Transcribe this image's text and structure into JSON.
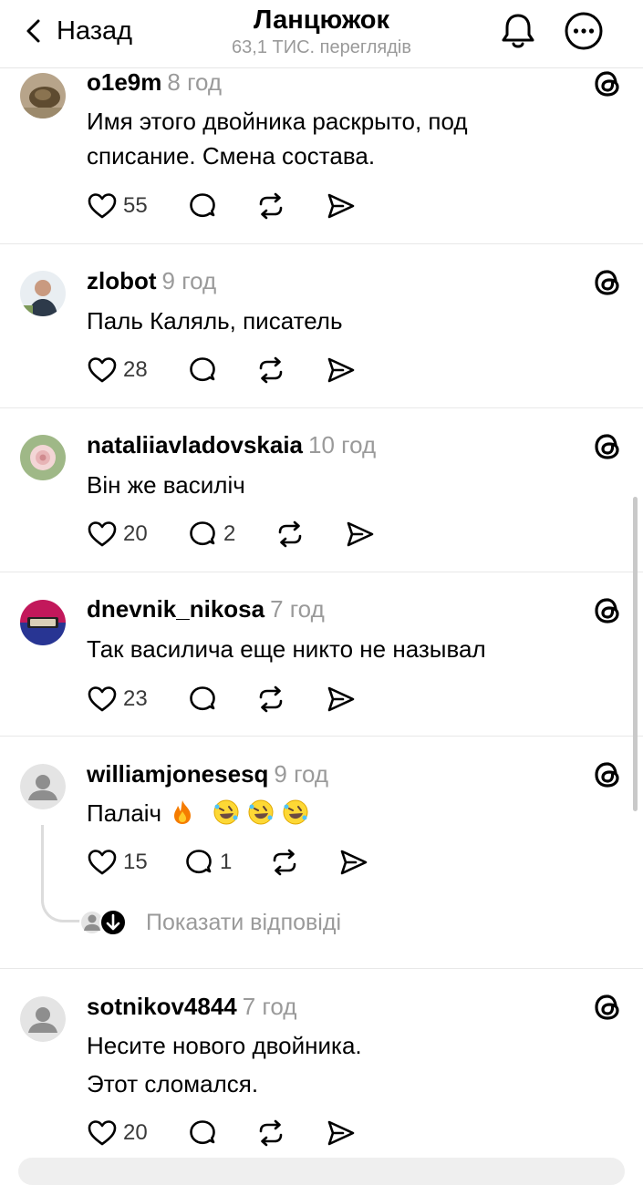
{
  "header": {
    "back_label": "Назад",
    "title": "Ланцюжок",
    "views": "63,1 ТИС. переглядів"
  },
  "posts": [
    {
      "user": "o1e9m",
      "time": "8 год",
      "lines": [
        "Имя этого двойника раскрыто, под",
        "списание. Смена состава."
      ],
      "likes": "55",
      "replies": ""
    },
    {
      "user": "zlobot",
      "time": "9 год",
      "lines": [
        "Паль Каляль, писатель"
      ],
      "likes": "28",
      "replies": ""
    },
    {
      "user": "nataliiavladovskaia",
      "time": "10 год",
      "lines": [
        "Він же василіч"
      ],
      "likes": "20",
      "replies": "2"
    },
    {
      "user": "dnevnik_nikosa",
      "time": "7 год",
      "lines": [
        "Так василича еще никто не называл"
      ],
      "likes": "23",
      "replies": ""
    },
    {
      "user": "williamjonesesq",
      "time": "9 год",
      "lines": [
        "Палаіч"
      ],
      "likes": "15",
      "replies": "1"
    },
    {
      "user": "sotnikov4844",
      "time": "7 год",
      "lines": [
        "Несите нового двойника.",
        "Этот сломался."
      ],
      "likes": "20",
      "replies": ""
    }
  ],
  "show_replies_label": "Показати відповіді",
  "icons": {
    "back": "chevron-left-icon",
    "bell": "bell-icon",
    "more": "more-horizontal-icon",
    "like": "heart-icon",
    "reply": "comment-bubble-icon",
    "repost": "repost-icon",
    "share": "send-icon",
    "threads": "threads-logo-icon",
    "fire": "fire-emoji",
    "laugh": "rolling-laugh-emoji"
  },
  "colors": {
    "text": "#000000",
    "muted": "#9a9a9a",
    "separator": "#e8e8e8"
  }
}
